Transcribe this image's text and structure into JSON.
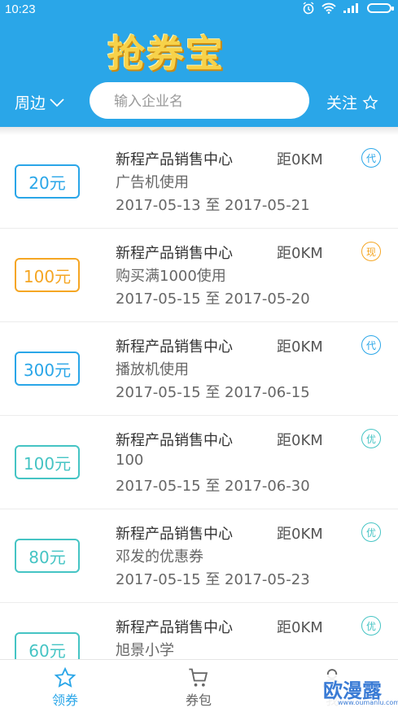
{
  "status_bar": {
    "time": "10:23"
  },
  "header": {
    "logo_text": "抢券宝",
    "location_label": "周边",
    "search_placeholder": "输入企业名",
    "follow_label": "关注"
  },
  "coupons": [
    {
      "amount": "20元",
      "company": "新程产品销售中心",
      "distance": "距0KM",
      "tag": "代",
      "desc": "广告机使用",
      "date_range": "2017-05-13 至 2017-05-21",
      "color": "#2aa6e8"
    },
    {
      "amount": "100元",
      "company": "新程产品销售中心",
      "distance": "距0KM",
      "tag": "现",
      "desc": "购买满1000使用",
      "date_range": "2017-05-15 至 2017-05-20",
      "color": "#f5a623"
    },
    {
      "amount": "300元",
      "company": "新程产品销售中心",
      "distance": "距0KM",
      "tag": "代",
      "desc": "播放机使用",
      "date_range": "2017-05-15 至 2017-06-15",
      "color": "#2aa6e8"
    },
    {
      "amount": "100元",
      "company": "新程产品销售中心",
      "distance": "距0KM",
      "tag": "优",
      "desc": "100",
      "date_range": "2017-05-15 至 2017-06-30",
      "color": "#45c4c4"
    },
    {
      "amount": "80元",
      "company": "新程产品销售中心",
      "distance": "距0KM",
      "tag": "优",
      "desc": "邓发的优惠券",
      "date_range": "2017-05-15 至 2017-05-23",
      "color": "#45c4c4"
    },
    {
      "amount": "60元",
      "company": "新程产品销售中心",
      "distance": "距0KM",
      "tag": "优",
      "desc": "旭景小学",
      "date_range": "",
      "color": "#45c4c4"
    }
  ],
  "tabs": [
    {
      "label": "领券",
      "icon": "star-icon",
      "active": true
    },
    {
      "label": "券包",
      "icon": "cart-icon",
      "active": false
    },
    {
      "label": "我",
      "icon": "person-icon",
      "active": false
    }
  ],
  "watermark": {
    "text": "欧漫露",
    "sub": "www.oumanlu.com"
  },
  "colors": {
    "primary": "#2aa6e8",
    "orange": "#f5a623",
    "teal": "#45c4c4"
  }
}
